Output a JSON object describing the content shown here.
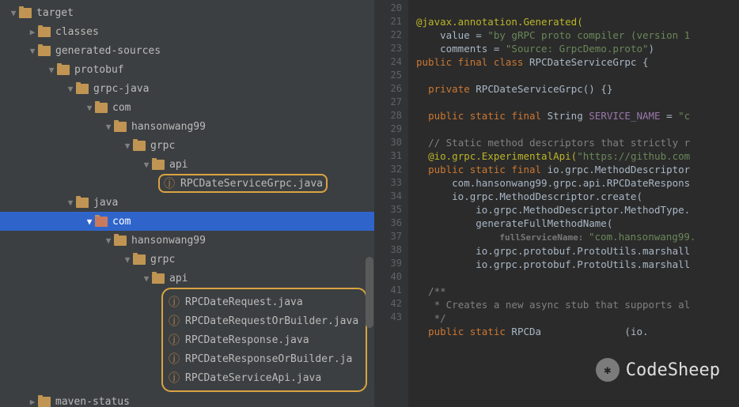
{
  "tree": {
    "root": "target",
    "children": {
      "classes": "classes",
      "generated": "generated-sources",
      "protobuf": "protobuf",
      "grpcjava": "grpc-java",
      "com1": "com",
      "hanson1": "hansonwang99",
      "grpc1": "grpc",
      "api1": "api",
      "file1": "RPCDateServiceGrpc.java",
      "java": "java",
      "com2": "com",
      "hanson2": "hansonwang99",
      "grpc2": "grpc",
      "api2": "api",
      "f2": "RPCDateRequest.java",
      "f3": "RPCDateRequestOrBuilder.java",
      "f4": "RPCDateResponse.java",
      "f5": "RPCDateResponseOrBuilder.ja",
      "f6": "RPCDateServiceApi.java",
      "maven": "maven-status"
    }
  },
  "code": {
    "l20a": "@javax.annotation.Generated(",
    "l21_key": "value = ",
    "l21_str": "\"by gRPC proto compiler (version 1",
    "l22_key": "comments = ",
    "l22_str": "\"Source: GrpcDemo.proto\"",
    "l22_end": ")",
    "l23a": "public final class ",
    "l23b": "RPCDateServiceGrpc {",
    "l25a": "private ",
    "l25b": "RPCDateServiceGrpc() {}",
    "l27a": "public static final ",
    "l27b": "String ",
    "l27c": "SERVICE_NAME",
    "l27d": " = ",
    "l27e": "\"c",
    "l29": "// Static method descriptors that strictly r",
    "l30a": "@io.grpc.ExperimentalApi(",
    "l30b": "\"https://github.com",
    "l31a": "public static final ",
    "l31b": "io.grpc.MethodDescriptor",
    "l32": "com.hansonwang99.grpc.api.RPCDateRespons",
    "l33": "io.grpc.MethodDescriptor.create(",
    "l34": "io.grpc.MethodDescriptor.MethodType.",
    "l35": "generateFullMethodName(",
    "l36h": "fullServiceName: ",
    "l36s": "\"com.hansonwang99.",
    "l37": "io.grpc.protobuf.ProtoUtils.marshall",
    "l38": "io.grpc.protobuf.ProtoUtils.marshall",
    "l40": "/**",
    "l41": " * Creates a new async stub that supports al",
    "l42": " */",
    "l43a": "public static ",
    "l43b": "RPCDa",
    "l43c": "(io."
  },
  "gutter": {
    "start": 20,
    "end": 43
  },
  "watermark": {
    "text": "CodeSheep"
  }
}
